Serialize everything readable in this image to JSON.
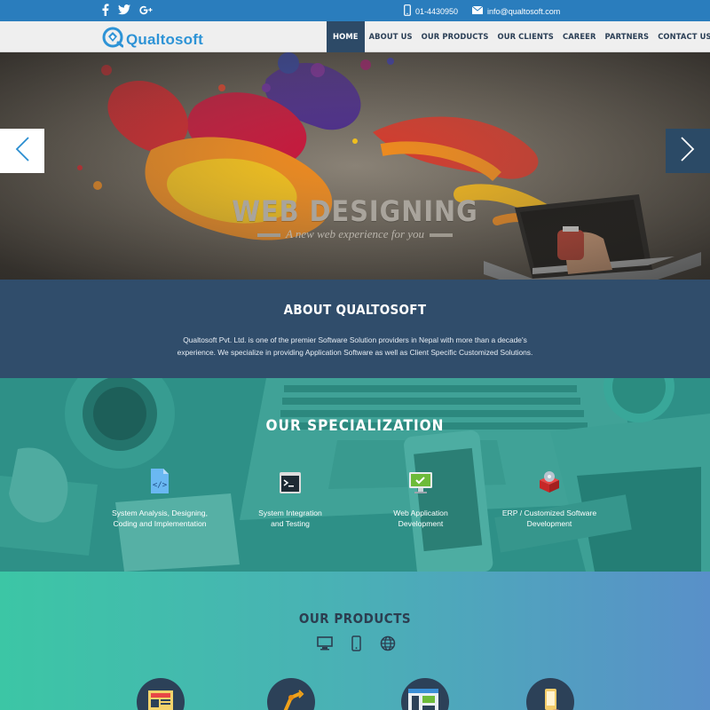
{
  "topbar": {
    "social": [
      "facebook-icon",
      "twitter-icon",
      "google-plus-icon"
    ],
    "phone": "01-4430950",
    "email": "info@qualtosoft.com"
  },
  "header": {
    "logo_text": "Qualtosoft",
    "nav": [
      {
        "label": "HOME",
        "active": true
      },
      {
        "label": "ABOUT US"
      },
      {
        "label": "OUR PRODUCTS"
      },
      {
        "label": "OUR CLIENTS"
      },
      {
        "label": "CAREER"
      },
      {
        "label": "PARTNERS"
      },
      {
        "label": "CONTACT US"
      }
    ]
  },
  "hero": {
    "title": "WEB DESIGNING",
    "subtitle": "A new web experience for you"
  },
  "about": {
    "title": "ABOUT QUALTOSOFT",
    "text": "Qualtosoft Pvt. Ltd. is one of the premier Software Solution providers in Nepal with more than a decade's experience. We specialize in providing Application Software as well as Client Specific Customized Solutions."
  },
  "specialization": {
    "title": "OUR SPECIALIZATION",
    "items": [
      {
        "line1": "System Analysis, Designing,",
        "line2": "Coding and Implementation",
        "icon": "code-file-icon"
      },
      {
        "line1": "System Integration",
        "line2": "and Testing",
        "icon": "terminal-icon"
      },
      {
        "line1": "Web Application",
        "line2": "Development",
        "icon": "monitor-check-icon"
      },
      {
        "line1": "ERP / Customized Software",
        "line2": "Development",
        "icon": "software-box-icon"
      }
    ]
  },
  "products": {
    "title": "OUR PRODUCTS",
    "tabs": [
      "desktop-icon",
      "mobile-icon",
      "globe-icon"
    ]
  },
  "colors": {
    "topbar": "#2a7dbd",
    "nav_active": "#2d4a67",
    "about_bg": "#304d6b",
    "spec_bg": "#2f8f86",
    "products_gradient_start": "#3cc6a5",
    "products_gradient_end": "#5990c9"
  }
}
